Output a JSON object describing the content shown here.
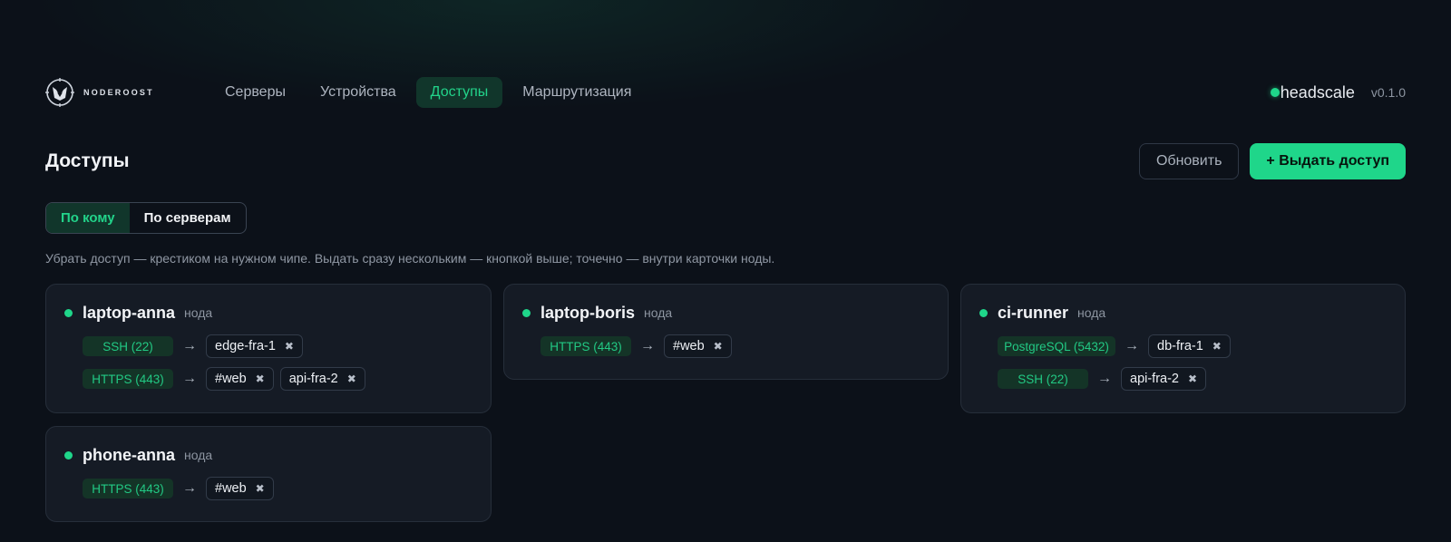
{
  "brand": {
    "name": "NODEROOST"
  },
  "nav": {
    "items": [
      {
        "label": "Серверы"
      },
      {
        "label": "Устройства"
      },
      {
        "label": "Доступы"
      },
      {
        "label": "Маршрутизация"
      }
    ],
    "active": "Доступы"
  },
  "server": {
    "name": "headscale",
    "version": "v0.1.0",
    "status_color": "#1fd68a"
  },
  "page": {
    "title": "Доступы",
    "refresh_label": "Обновить",
    "grant_label": "+ Выдать доступ",
    "tabs": [
      {
        "label": "По кому"
      },
      {
        "label": "По серверам"
      }
    ],
    "active_tab": "По кому",
    "hint": "Убрать доступ — крестиком на нужном чипе. Выдать сразу нескольким — кнопкой выше; точечно — внутри карточки ноды."
  },
  "colors": {
    "accent": "#1fd68a",
    "background": "#0c1119",
    "card": "#151b25"
  },
  "arrow": "→",
  "remove_icon": "✖",
  "nodes": [
    {
      "name": "laptop-anna",
      "type": "нода",
      "rules": [
        {
          "service": "SSH (22)",
          "targets": [
            "edge-fra-1"
          ]
        },
        {
          "service": "HTTPS (443)",
          "targets": [
            "#web",
            "api-fra-2"
          ]
        }
      ]
    },
    {
      "name": "laptop-boris",
      "type": "нода",
      "rules": [
        {
          "service": "HTTPS (443)",
          "targets": [
            "#web"
          ]
        }
      ]
    },
    {
      "name": "ci-runner",
      "type": "нода",
      "rules": [
        {
          "service": "PostgreSQL (5432)",
          "targets": [
            "db-fra-1"
          ]
        },
        {
          "service": "SSH (22)",
          "targets": [
            "api-fra-2"
          ]
        }
      ]
    },
    {
      "name": "phone-anna",
      "type": "нода",
      "rules": [
        {
          "service": "HTTPS (443)",
          "targets": [
            "#web"
          ]
        }
      ]
    }
  ]
}
